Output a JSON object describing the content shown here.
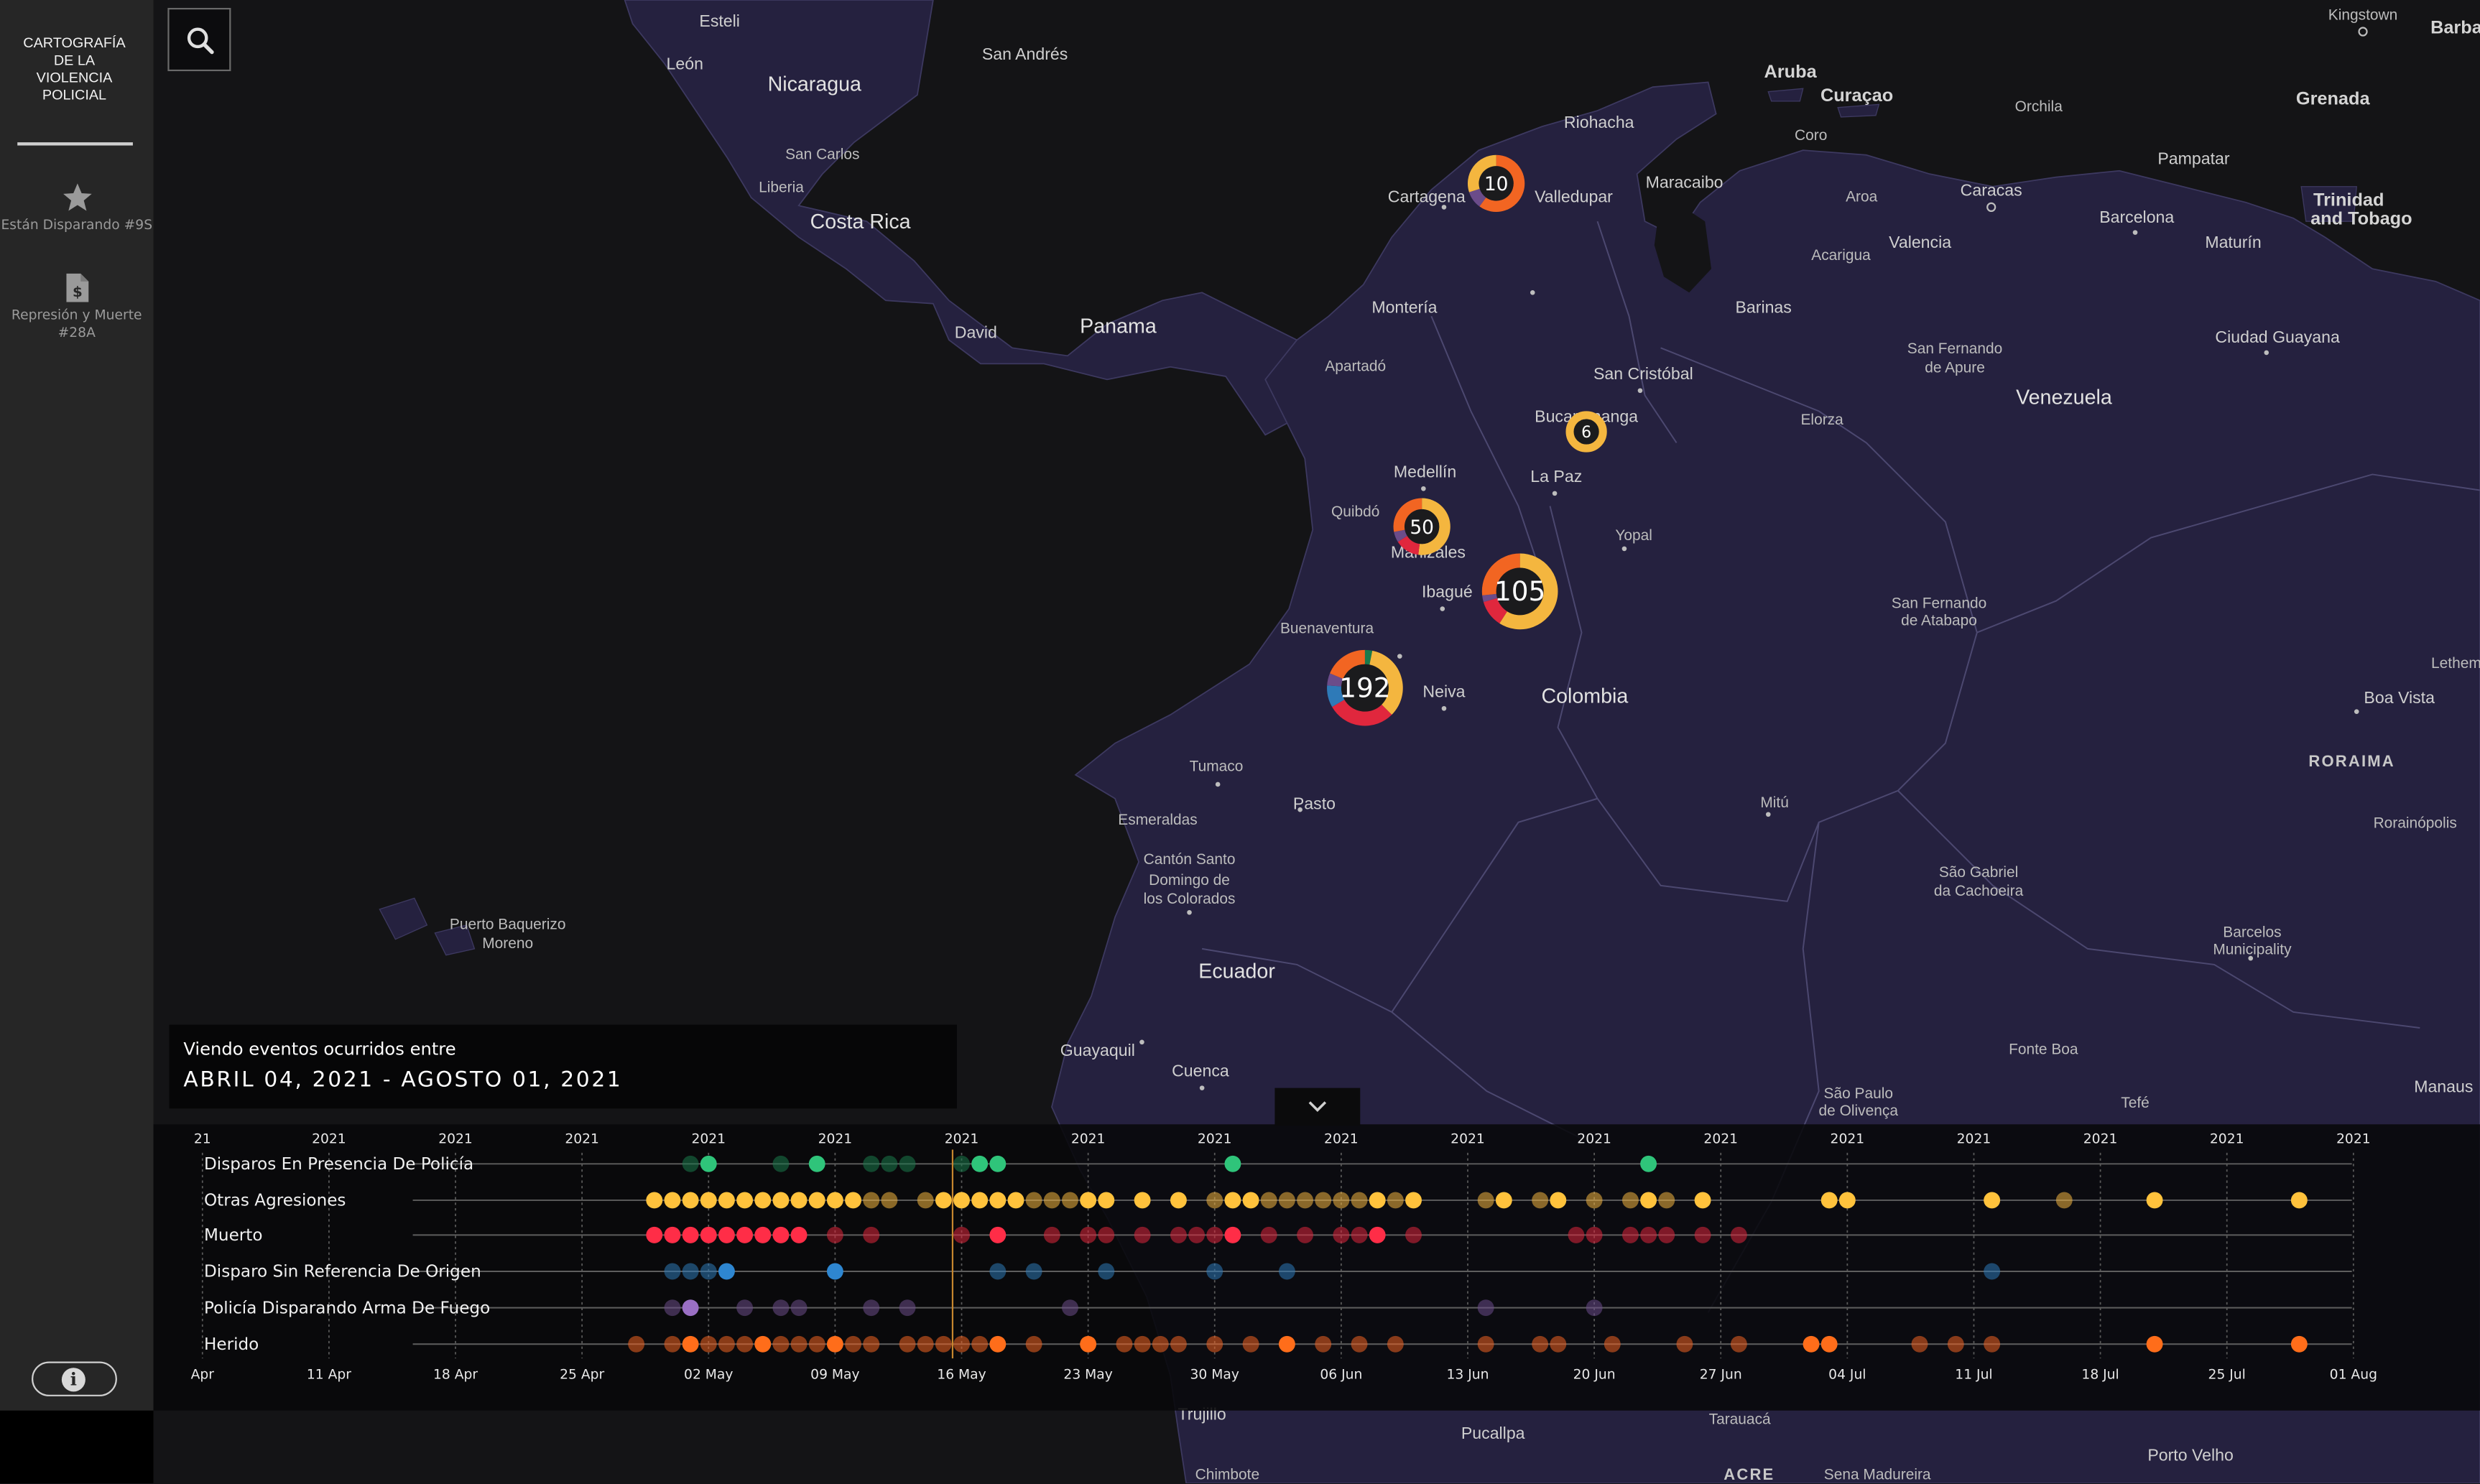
{
  "app": {
    "title_lines": [
      "CARTOGRAFÍA",
      "DE LA",
      "VIOLENCIA",
      "POLICIAL"
    ]
  },
  "sidebar": {
    "items": [
      {
        "label_lines": [
          "Están Disparando #9S"
        ],
        "icon": "star-icon"
      },
      {
        "label_lines": [
          "Represión y Muerte",
          "#28A"
        ],
        "icon": "document-dollar-icon"
      }
    ],
    "info_icon": "info-icon"
  },
  "search": {
    "icon": "search-icon"
  },
  "map": {
    "labels": [
      {
        "text": "Esteli",
        "kind": "city"
      },
      {
        "text": "León",
        "kind": "city"
      },
      {
        "text": "Nicaragua",
        "kind": "country"
      },
      {
        "text": "San Andrés",
        "kind": "city"
      },
      {
        "text": "San Carlos",
        "kind": "town"
      },
      {
        "text": "Liberia",
        "kind": "town"
      },
      {
        "text": "Costa Rica",
        "kind": "country"
      },
      {
        "text": "David",
        "kind": "city"
      },
      {
        "text": "Panama",
        "kind": "country"
      },
      {
        "text": "Aruba",
        "kind": "region"
      },
      {
        "text": "Curaçao",
        "kind": "region"
      },
      {
        "text": "Orchila",
        "kind": "town"
      },
      {
        "text": "Grenada",
        "kind": "region"
      },
      {
        "text": "Kingstown",
        "kind": "town"
      },
      {
        "text": "Barba",
        "kind": "region"
      },
      {
        "text": "Riohacha",
        "kind": "city"
      },
      {
        "text": "Coro",
        "kind": "town"
      },
      {
        "text": "Pampatar",
        "kind": "city"
      },
      {
        "text": "Trinidad",
        "kind": "region"
      },
      {
        "text": "and Tobago",
        "kind": "region"
      },
      {
        "text": "Cartagena",
        "kind": "city"
      },
      {
        "text": "Valledupar",
        "kind": "city"
      },
      {
        "text": "Maracaibo",
        "kind": "city"
      },
      {
        "text": "Aroa",
        "kind": "town"
      },
      {
        "text": "Caracas",
        "kind": "city"
      },
      {
        "text": "Barcelona",
        "kind": "city"
      },
      {
        "text": "Maturín",
        "kind": "city"
      },
      {
        "text": "Acarigua",
        "kind": "town"
      },
      {
        "text": "Valencia",
        "kind": "city"
      },
      {
        "text": "Montería",
        "kind": "city"
      },
      {
        "text": "Barinas",
        "kind": "city"
      },
      {
        "text": "San Fernando",
        "kind": "town"
      },
      {
        "text": "de Apure",
        "kind": "town"
      },
      {
        "text": "Ciudad Guayana",
        "kind": "city"
      },
      {
        "text": "Apartadó",
        "kind": "town"
      },
      {
        "text": "San Cristóbal",
        "kind": "city"
      },
      {
        "text": "Venezuela",
        "kind": "country"
      },
      {
        "text": "Bucaramanga",
        "kind": "city"
      },
      {
        "text": "Elorza",
        "kind": "town"
      },
      {
        "text": "Medellín",
        "kind": "city"
      },
      {
        "text": "La Paz",
        "kind": "city"
      },
      {
        "text": "Quibdó",
        "kind": "town"
      },
      {
        "text": "Manizales",
        "kind": "city"
      },
      {
        "text": "Yopal",
        "kind": "town"
      },
      {
        "text": "Ibagué",
        "kind": "city"
      },
      {
        "text": "San Fernando",
        "kind": "town"
      },
      {
        "text": "de Atabapo",
        "kind": "town"
      },
      {
        "text": "Buenaventura",
        "kind": "town"
      },
      {
        "text": "Neiva",
        "kind": "city"
      },
      {
        "text": "Colombia",
        "kind": "country"
      },
      {
        "text": "RORAIMA",
        "kind": "state"
      },
      {
        "text": "Boa Vista",
        "kind": "city"
      },
      {
        "text": "Lethem",
        "kind": "town"
      },
      {
        "text": "Tumaco",
        "kind": "town"
      },
      {
        "text": "Pasto",
        "kind": "city"
      },
      {
        "text": "Mitú",
        "kind": "town"
      },
      {
        "text": "Rorainópolis",
        "kind": "town"
      },
      {
        "text": "Esmeraldas",
        "kind": "town"
      },
      {
        "text": "Cantón Santo",
        "kind": "town"
      },
      {
        "text": "Domingo de",
        "kind": "town"
      },
      {
        "text": "los Colorados",
        "kind": "town"
      },
      {
        "text": "São Gabriel",
        "kind": "town"
      },
      {
        "text": "da Cachoeira",
        "kind": "town"
      },
      {
        "text": "Puerto Baquerizo",
        "kind": "town"
      },
      {
        "text": "Moreno",
        "kind": "town"
      },
      {
        "text": "Barcelos",
        "kind": "town"
      },
      {
        "text": "Municipality",
        "kind": "town"
      },
      {
        "text": "Ecuador",
        "kind": "country"
      },
      {
        "text": "Guayaquil",
        "kind": "city"
      },
      {
        "text": "Cuenca",
        "kind": "city"
      },
      {
        "text": "Fonte Boa",
        "kind": "town"
      },
      {
        "text": "São Paulo",
        "kind": "town"
      },
      {
        "text": "de Olivença",
        "kind": "town"
      },
      {
        "text": "Tefé",
        "kind": "town"
      },
      {
        "text": "Manaus",
        "kind": "city"
      },
      {
        "text": "Pucallpa",
        "kind": "city"
      },
      {
        "text": "Tarauacá",
        "kind": "town"
      },
      {
        "text": "Porto Velho",
        "kind": "city"
      },
      {
        "text": "Trujillo",
        "kind": "city"
      },
      {
        "text": "ACRE",
        "kind": "state"
      },
      {
        "text": "Sena Madureira",
        "kind": "town"
      },
      {
        "text": "Chimbote",
        "kind": "town"
      }
    ],
    "clusters": [
      {
        "count": "10",
        "segments": [
          {
            "color": "#f26522",
            "value": 6
          },
          {
            "color": "#6b4c8a",
            "value": 1
          },
          {
            "color": "#f4b63f",
            "value": 3
          }
        ]
      },
      {
        "count": "6",
        "segments": [
          {
            "color": "#f4b63f",
            "value": 6
          }
        ]
      },
      {
        "count": "50",
        "segments": [
          {
            "color": "#f4b63f",
            "value": 26
          },
          {
            "color": "#e0273d",
            "value": 7
          },
          {
            "color": "#6b4c8a",
            "value": 3
          },
          {
            "color": "#f26522",
            "value": 14
          }
        ]
      },
      {
        "count": "105",
        "segments": [
          {
            "color": "#f4b63f",
            "value": 62
          },
          {
            "color": "#e0273d",
            "value": 12
          },
          {
            "color": "#6b4c8a",
            "value": 3
          },
          {
            "color": "#f26522",
            "value": 28
          }
        ]
      },
      {
        "count": "192",
        "segments": [
          {
            "color": "#1a7a4c",
            "value": 6
          },
          {
            "color": "#f4b63f",
            "value": 66
          },
          {
            "color": "#e0273d",
            "value": 56
          },
          {
            "color": "#2e7ab8",
            "value": 18
          },
          {
            "color": "#6b4c8a",
            "value": 10
          },
          {
            "color": "#f26522",
            "value": 36
          }
        ]
      }
    ]
  },
  "range": {
    "label": "Viendo eventos ocurridos entre",
    "value": "ABRIL 04, 2021 - AGOSTO 01, 2021"
  },
  "timeline": {
    "collapse_icon": "chevron-down-icon",
    "year_ticks": [
      "21",
      "2021",
      "2021",
      "2021",
      "2021",
      "2021",
      "2021",
      "2021",
      "2021",
      "2021",
      "2021",
      "2021",
      "2021",
      "2021",
      "2021",
      "2021",
      "2021",
      "2021"
    ],
    "date_ticks": [
      "Apr",
      "11 Apr",
      "18 Apr",
      "25 Apr",
      "02 May",
      "09 May",
      "16 May",
      "23 May",
      "30 May",
      "06 Jun",
      "13 Jun",
      "20 Jun",
      "27 Jun",
      "04 Jul",
      "11 Jul",
      "18 Jul",
      "25 Jul",
      "01 Aug"
    ],
    "cursor_day": 41.5,
    "rows": [
      {
        "label": "Disparos En Presencia De Policía",
        "color": "#1a7a4c",
        "bright": "#2fc47a",
        "days": [
          27,
          28,
          32,
          34,
          37,
          38,
          39,
          42,
          43,
          44,
          57,
          80
        ],
        "highlight": [
          28,
          34,
          43,
          44,
          57,
          80
        ]
      },
      {
        "label": "Otras Agresiones",
        "color": "#f4b63f",
        "bright": "#ffc23c",
        "days": [
          25,
          26,
          27,
          28,
          29,
          30,
          31,
          32,
          33,
          34,
          35,
          36,
          37,
          38,
          40,
          41,
          42,
          43,
          44,
          45,
          46,
          47,
          48,
          49,
          50,
          52,
          54,
          56,
          57,
          58,
          59,
          60,
          61,
          62,
          63,
          64,
          65,
          66,
          67,
          71,
          72,
          74,
          75,
          77,
          79,
          80,
          81,
          83,
          90,
          91,
          99,
          103,
          108,
          116
        ],
        "highlight": [
          25,
          26,
          27,
          28,
          29,
          30,
          31,
          32,
          33,
          34,
          35,
          36,
          41,
          42,
          43,
          44,
          45,
          49,
          50,
          52,
          54,
          57,
          58,
          65,
          67,
          72,
          75,
          80,
          83,
          90,
          91,
          99,
          108,
          116
        ]
      },
      {
        "label": "Muerto",
        "color": "#e0273d",
        "bright": "#ff2d47",
        "days": [
          25,
          26,
          27,
          28,
          29,
          30,
          31,
          32,
          33,
          35,
          37,
          42,
          44,
          47,
          49,
          50,
          52,
          54,
          55,
          56,
          57,
          59,
          61,
          63,
          64,
          65,
          67,
          76,
          77,
          79,
          80,
          81,
          83,
          85
        ],
        "highlight": [
          25,
          26,
          27,
          28,
          29,
          30,
          31,
          32,
          33,
          44,
          57,
          65
        ]
      },
      {
        "label": "Disparo Sin Referencia De Origen",
        "color": "#2e7ab8",
        "bright": "#2e86d0",
        "days": [
          26,
          27,
          28,
          29,
          35,
          44,
          46,
          50,
          56,
          60,
          99
        ],
        "highlight": [
          29,
          35
        ]
      },
      {
        "label": "Policía Disparando Arma De Fuego",
        "color": "#6b4c8a",
        "bright": "#9a6fc4",
        "days": [
          26,
          27,
          30,
          32,
          33,
          37,
          39,
          48,
          71,
          77
        ],
        "highlight": [
          27
        ]
      },
      {
        "label": "Herido",
        "color": "#f26522",
        "bright": "#ff6d1a",
        "days": [
          24,
          26,
          27,
          28,
          29,
          30,
          31,
          32,
          33,
          34,
          35,
          36,
          37,
          39,
          40,
          41,
          42,
          43,
          44,
          46,
          49,
          51,
          52,
          53,
          54,
          56,
          58,
          60,
          62,
          64,
          66,
          71,
          74,
          75,
          78,
          82,
          85,
          89,
          90,
          95,
          97,
          99,
          108,
          116
        ],
        "highlight": [
          27,
          31,
          35,
          44,
          49,
          60,
          89,
          90,
          108,
          116
        ]
      }
    ]
  }
}
